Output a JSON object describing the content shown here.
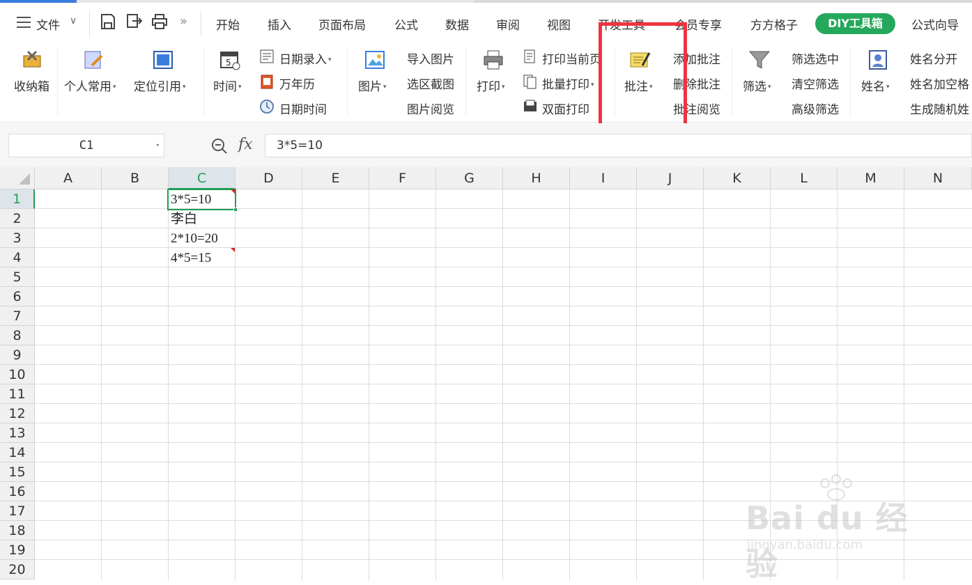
{
  "menu": {
    "file": "文件",
    "tabs": [
      "开始",
      "插入",
      "页面布局",
      "公式",
      "数据",
      "审阅",
      "视图",
      "开发工具",
      "会员专享",
      "方方格子",
      "DIY工具箱",
      "公式向导"
    ]
  },
  "ribbon": {
    "storage": "收纳箱",
    "personal": "个人常用",
    "locate_ref": "定位引用",
    "time": "时间",
    "date_entry": "日期录入",
    "perpetual_cal": "万年历",
    "date_time": "日期时间",
    "picture": "图片",
    "import_pic": "导入图片",
    "screenshot": "选区截图",
    "pic_view": "图片阅览",
    "print": "打印",
    "print_current": "打印当前页",
    "batch_print": "批量打印",
    "duplex_print": "双面打印",
    "comment": "批注",
    "add_comment": "添加批注",
    "delete_comment": "删除批注",
    "view_comment": "批注阅览",
    "filter": "筛选",
    "filter_selected": "筛选选中",
    "clear_filter": "清空筛选",
    "advanced_filter": "高级筛选",
    "name": "姓名",
    "split_name": "姓名分开",
    "name_space": "姓名加空格",
    "random_name": "生成随机姓"
  },
  "formula_bar": {
    "cell_ref": "C1",
    "content": "3*5=10"
  },
  "grid": {
    "columns": [
      "A",
      "B",
      "C",
      "D",
      "E",
      "F",
      "G",
      "H",
      "I",
      "J",
      "K",
      "L",
      "M",
      "N"
    ],
    "rows": [
      "1",
      "2",
      "3",
      "4",
      "5",
      "6",
      "7",
      "8",
      "9",
      "10",
      "11",
      "12",
      "13",
      "14",
      "15",
      "16",
      "17",
      "18",
      "19",
      "20"
    ],
    "cells": [
      "3*5=10",
      "李白",
      "2*10=20",
      "4*5=15"
    ]
  },
  "watermark": {
    "brand": "Bai du 经验",
    "url": "jingyan.baidu.com"
  },
  "colors": {
    "accent_green": "#1f9e57",
    "diy_green": "#26a85c",
    "highlight_red": "#ef3340"
  }
}
